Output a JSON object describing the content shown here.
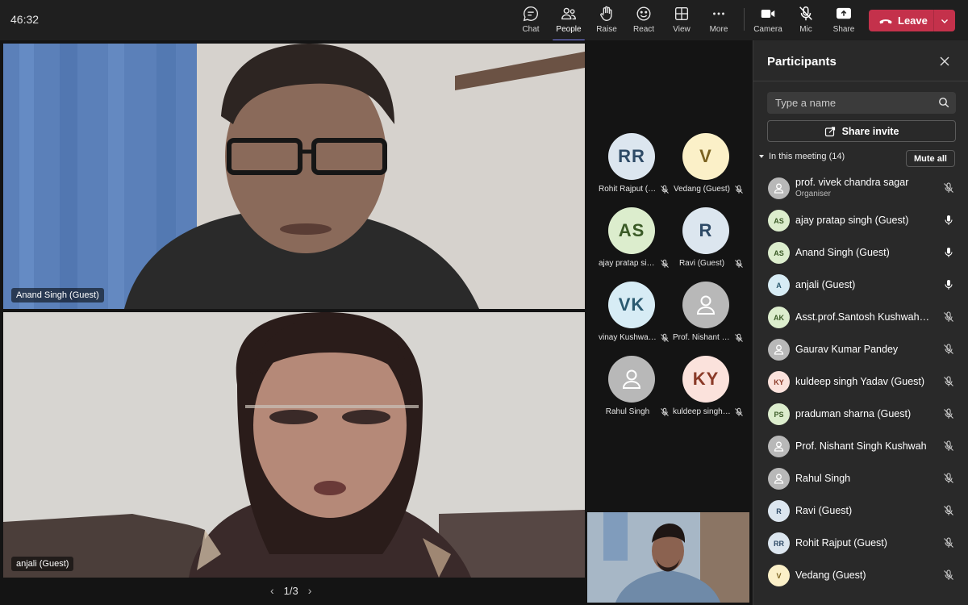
{
  "meeting": {
    "timer": "46:32",
    "toolbar": [
      {
        "label": "Chat",
        "icon": "chat-icon"
      },
      {
        "label": "People",
        "icon": "people-icon",
        "active": true
      },
      {
        "label": "Raise",
        "icon": "raise-hand-icon"
      },
      {
        "label": "React",
        "icon": "react-icon"
      },
      {
        "label": "View",
        "icon": "view-icon"
      },
      {
        "label": "More",
        "icon": "more-icon"
      },
      {
        "label": "Camera",
        "icon": "camera-icon"
      },
      {
        "label": "Mic",
        "icon": "mic-off-icon"
      },
      {
        "label": "Share",
        "icon": "share-icon"
      }
    ],
    "leave_label": "Leave",
    "accent_color": "#7f85f5",
    "leave_color": "#c4314b"
  },
  "stage": {
    "videos": [
      {
        "name": "Anand Singh (Guest)"
      },
      {
        "name": "anjali (Guest)"
      }
    ],
    "pager": "1/3",
    "tiles": [
      {
        "initials": "RR",
        "name": "Rohit Rajput (Guest)",
        "tone": "c-rr"
      },
      {
        "initials": "V",
        "name": "Vedang (Guest)",
        "tone": "c-v"
      },
      {
        "initials": "AS",
        "name": "ajay pratap singh (Guest)",
        "tone": "c-as"
      },
      {
        "initials": "R",
        "name": "Ravi (Guest)",
        "tone": "c-r"
      },
      {
        "initials": "VK",
        "name": "vinay Kushwaha (Guest)",
        "tone": "c-vk"
      },
      {
        "initials": "",
        "name": "Prof. Nishant Singh Kushwah",
        "tone": "c-gen"
      },
      {
        "initials": "",
        "name": "Rahul Singh",
        "tone": "c-gen"
      },
      {
        "initials": "KY",
        "name": "kuldeep singh Yadav (Guest)",
        "tone": "c-ky"
      }
    ]
  },
  "panel": {
    "title": "Participants",
    "search_placeholder": "Type a name",
    "invite_label": "Share invite",
    "section_label": "In this meeting (14)",
    "mute_all_label": "Mute all",
    "participants": [
      {
        "initials": "",
        "name": "prof. vivek chandra sagar",
        "role": "Organiser",
        "mic": "off",
        "tone": "c-gen"
      },
      {
        "initials": "AS",
        "name": "ajay pratap singh (Guest)",
        "role": "",
        "mic": "on",
        "tone": "c-as"
      },
      {
        "initials": "AS",
        "name": "Anand Singh (Guest)",
        "role": "",
        "mic": "on",
        "tone": "c-as"
      },
      {
        "initials": "A",
        "name": "anjali (Guest)",
        "role": "",
        "mic": "on",
        "tone": "c-vk"
      },
      {
        "initials": "AK",
        "name": "Asst.prof.Santosh Kushwaha (Guest)",
        "role": "",
        "mic": "off",
        "tone": "c-as"
      },
      {
        "initials": "",
        "name": "Gaurav Kumar Pandey",
        "role": "",
        "mic": "off",
        "tone": "c-gen"
      },
      {
        "initials": "KY",
        "name": "kuldeep singh Yadav (Guest)",
        "role": "",
        "mic": "off",
        "tone": "c-ky"
      },
      {
        "initials": "PS",
        "name": "praduman sharna (Guest)",
        "role": "",
        "mic": "off",
        "tone": "c-as"
      },
      {
        "initials": "",
        "name": "Prof. Nishant Singh Kushwah",
        "role": "",
        "mic": "off",
        "tone": "c-gen"
      },
      {
        "initials": "",
        "name": "Rahul Singh",
        "role": "",
        "mic": "off",
        "tone": "c-gen"
      },
      {
        "initials": "R",
        "name": "Ravi (Guest)",
        "role": "",
        "mic": "off",
        "tone": "c-r"
      },
      {
        "initials": "RR",
        "name": "Rohit Rajput (Guest)",
        "role": "",
        "mic": "off",
        "tone": "c-rr"
      },
      {
        "initials": "V",
        "name": "Vedang (Guest)",
        "role": "",
        "mic": "off",
        "tone": "c-v"
      }
    ]
  }
}
